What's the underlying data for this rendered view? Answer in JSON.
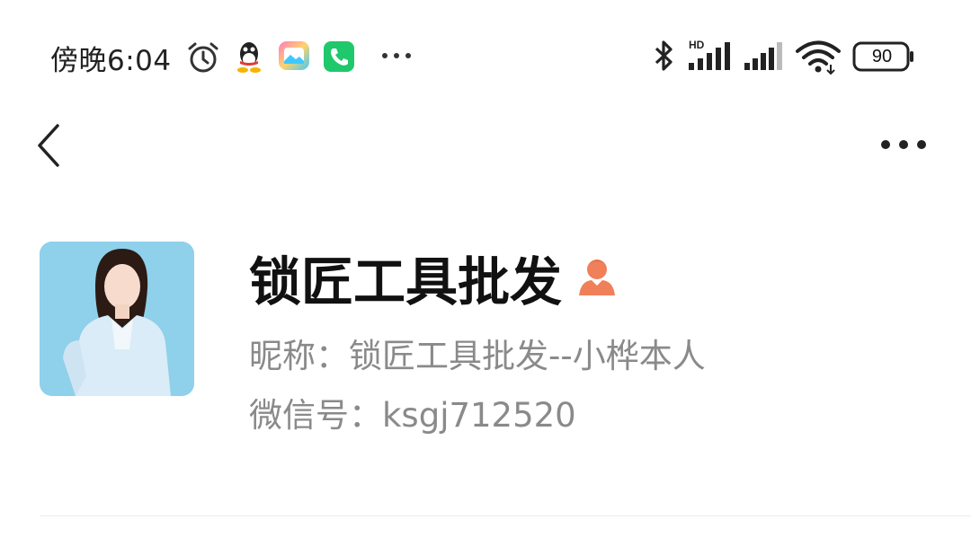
{
  "status_bar": {
    "time": "傍晚6:04",
    "battery": "90",
    "icons": [
      "alarm-icon",
      "qq-icon",
      "gallery-icon",
      "phone-app-icon",
      "more-notifications-icon",
      "bluetooth-icon",
      "hd-signal-icon",
      "signal-icon",
      "wifi-icon",
      "battery-icon"
    ]
  },
  "nav": {
    "back_icon": "back-chevron-icon",
    "more_icon": "more-dots-icon"
  },
  "profile": {
    "name": "锁匠工具批发",
    "gender_icon": "female-gender-icon",
    "nickname_label": "昵称：",
    "nickname": "锁匠工具批发--小桦本人",
    "wechat_label": "微信号：",
    "wechat_id": "ksgj712520"
  },
  "colors": {
    "gender_icon": "#f0805a",
    "avatar_bg": "#8fd0ea",
    "secondary_text": "#8a8a8a"
  }
}
